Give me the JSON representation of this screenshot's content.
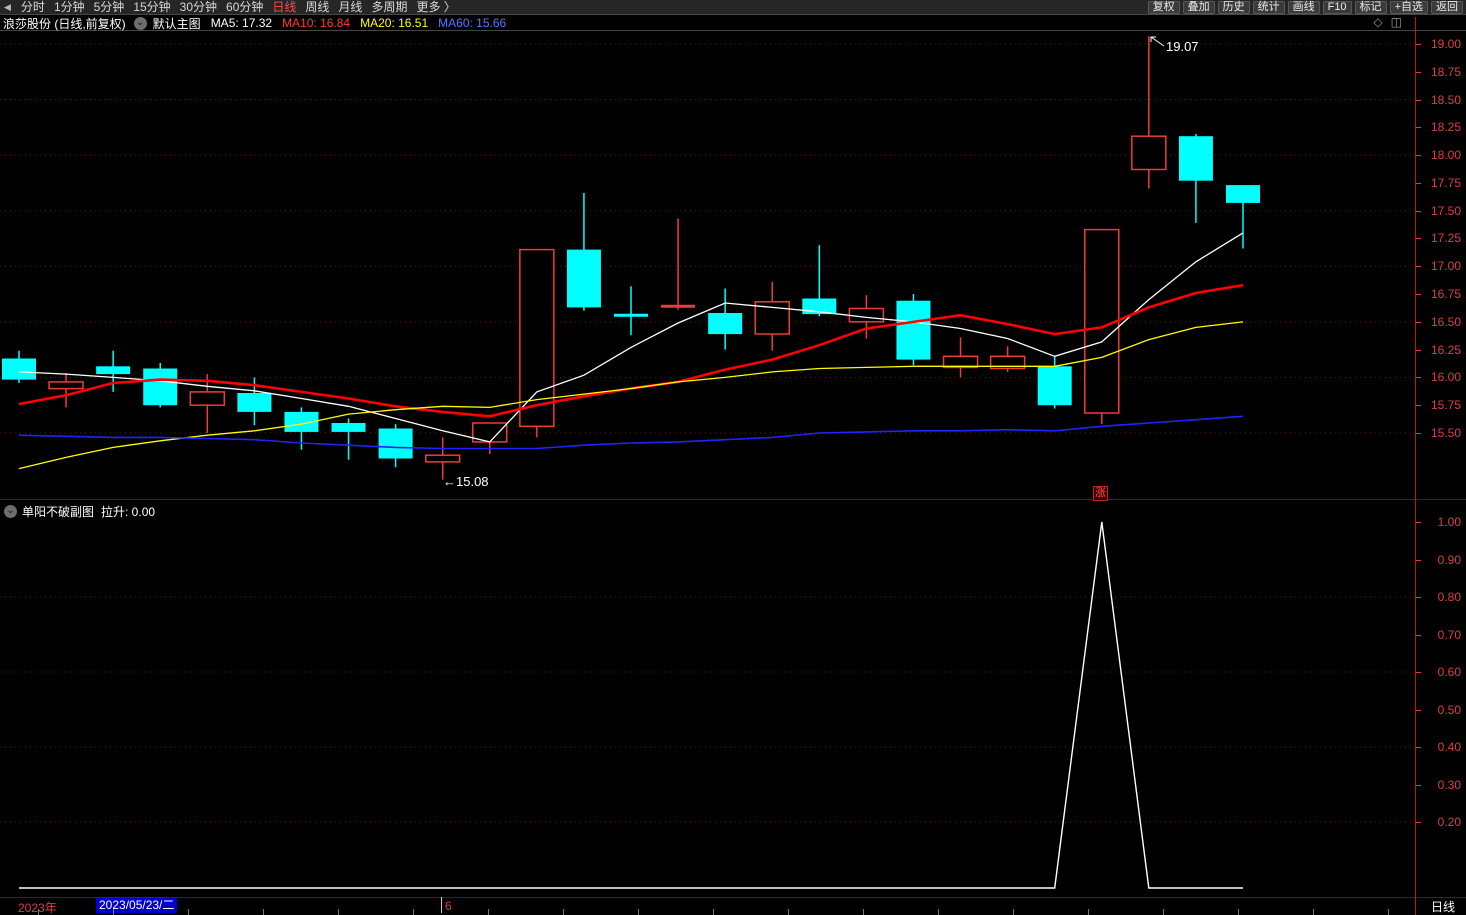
{
  "menubar": {
    "collapse_icon": "◀",
    "items": [
      {
        "label": "分时"
      },
      {
        "label": "1分钟"
      },
      {
        "label": "5分钟"
      },
      {
        "label": "15分钟"
      },
      {
        "label": "30分钟"
      },
      {
        "label": "60分钟"
      },
      {
        "label": "日线",
        "active": true
      },
      {
        "label": "周线"
      },
      {
        "label": "月线"
      },
      {
        "label": "多周期"
      },
      {
        "label": "更多 〉"
      }
    ],
    "right_items": [
      "复权",
      "叠加",
      "历史",
      "统计",
      "画线",
      "F10",
      "标记",
      "+自选",
      "返回"
    ]
  },
  "titlebar": {
    "stock_title": "浪莎股份 (日线,前复权)",
    "chevron_icon": "⌄",
    "layout_label": "默认主图",
    "ma_legend": [
      {
        "label": "MA5: 17.32",
        "color": "#ffffff"
      },
      {
        "label": "MA10: 16.84",
        "color": "#ff3a3a"
      },
      {
        "label": "MA20: 16.51",
        "color": "#ffff00"
      },
      {
        "label": "MA60: 15.66",
        "color": "#5577ff"
      }
    ],
    "diamond_icon": "◇",
    "split_icon": "◫"
  },
  "sub_chart": {
    "chevron_icon": "⌄",
    "name": "单阳不破副图",
    "value_label": "拉升: 0.00"
  },
  "annotations": {
    "high_label": "19.07",
    "low_label": "←15.08",
    "zhang_badge": "涨"
  },
  "right_axis": {
    "price_labels": [
      "19.00",
      "18.75",
      "18.50",
      "18.25",
      "18.00",
      "17.75",
      "17.50",
      "17.25",
      "17.00",
      "16.75",
      "16.50",
      "16.25",
      "16.00",
      "15.75",
      "15.50"
    ],
    "sub_labels": [
      "1.00",
      "0.90",
      "0.80",
      "0.70",
      "0.60",
      "0.50",
      "0.40",
      "0.30",
      "0.20"
    ],
    "period_label": "日线"
  },
  "datebar": {
    "year_label": "2023年",
    "selected_date": "2023/05/23/二",
    "month_label": "6"
  },
  "colors": {
    "up": "#ee3b3b",
    "down": "#00ffff",
    "grid": "#7c0a0a",
    "axis_text": "#d84040",
    "divider_red": "#8b0000",
    "axis_border": "#b31b1b",
    "date_highlight": "#0000cc",
    "spike": "#ffffff"
  },
  "chart_data": {
    "type": "candlestick",
    "title": "浪莎股份 日线 前复权 主图(MA5/MA10/MA20/MA60) + 单阳不破副图",
    "price_axis_visible_range": [
      15.5,
      19.0
    ],
    "sub_axis_visible_range": [
      0.2,
      1.0
    ],
    "price_gridlines": [
      19.0,
      18.5,
      18.0,
      17.5,
      17.0,
      16.5,
      16.0,
      15.5
    ],
    "sub_gridlines": [
      0.8,
      0.6,
      0.4,
      0.2
    ],
    "annotated_high": 19.07,
    "annotated_low": 15.08,
    "candles": [
      {
        "o": 16.17,
        "h": 16.24,
        "l": 15.95,
        "c": 15.98
      },
      {
        "o": 15.9,
        "h": 16.04,
        "l": 15.73,
        "c": 15.96
      },
      {
        "o": 16.1,
        "h": 16.24,
        "l": 15.87,
        "c": 16.03
      },
      {
        "o": 16.08,
        "h": 16.13,
        "l": 15.73,
        "c": 15.75
      },
      {
        "o": 15.75,
        "h": 16.03,
        "l": 15.5,
        "c": 15.87
      },
      {
        "o": 15.86,
        "h": 16.0,
        "l": 15.57,
        "c": 15.69
      },
      {
        "o": 15.69,
        "h": 15.73,
        "l": 15.35,
        "c": 15.51
      },
      {
        "o": 15.59,
        "h": 15.63,
        "l": 15.26,
        "c": 15.51
      },
      {
        "o": 15.54,
        "h": 15.58,
        "l": 15.19,
        "c": 15.27
      },
      {
        "o": 15.24,
        "h": 15.46,
        "l": 15.08,
        "c": 15.3
      },
      {
        "o": 15.42,
        "h": 15.59,
        "l": 15.31,
        "c": 15.59
      },
      {
        "o": 15.56,
        "h": 17.15,
        "l": 15.46,
        "c": 17.15
      },
      {
        "o": 17.15,
        "h": 17.66,
        "l": 16.6,
        "c": 16.63
      },
      {
        "o": 16.56,
        "h": 16.82,
        "l": 16.38,
        "c": 16.55
      },
      {
        "o": 16.64,
        "h": 17.43,
        "l": 16.61,
        "c": 16.64
      },
      {
        "o": 16.58,
        "h": 16.8,
        "l": 16.25,
        "c": 16.39
      },
      {
        "o": 16.39,
        "h": 16.86,
        "l": 16.24,
        "c": 16.68
      },
      {
        "o": 16.71,
        "h": 17.19,
        "l": 16.55,
        "c": 16.57
      },
      {
        "o": 16.5,
        "h": 16.74,
        "l": 16.35,
        "c": 16.62
      },
      {
        "o": 16.69,
        "h": 16.75,
        "l": 16.11,
        "c": 16.16
      },
      {
        "o": 16.09,
        "h": 16.36,
        "l": 16.0,
        "c": 16.19
      },
      {
        "o": 16.08,
        "h": 16.28,
        "l": 16.05,
        "c": 16.19
      },
      {
        "o": 16.1,
        "h": 16.19,
        "l": 15.72,
        "c": 15.75
      },
      {
        "o": 15.68,
        "h": 17.33,
        "l": 15.58,
        "c": 17.33
      },
      {
        "o": 17.87,
        "h": 19.07,
        "l": 17.7,
        "c": 18.17
      },
      {
        "o": 18.17,
        "h": 18.19,
        "l": 17.39,
        "c": 17.77
      },
      {
        "o": 17.73,
        "h": 17.73,
        "l": 17.16,
        "c": 17.57
      }
    ],
    "ma_series": [
      {
        "name": "MA5",
        "color": "#ffffff",
        "width": 1.3,
        "values": [
          16.05,
          16.03,
          16.0,
          15.97,
          15.92,
          15.88,
          15.81,
          15.74,
          15.63,
          15.52,
          15.42,
          15.87,
          16.02,
          16.27,
          16.49,
          16.67,
          16.63,
          16.59,
          16.54,
          16.5,
          16.44,
          16.35,
          16.19,
          16.32,
          16.7,
          17.04,
          17.3
        ]
      },
      {
        "name": "MA10",
        "color": "#ff0000",
        "width": 2.6,
        "values": [
          15.76,
          15.84,
          15.95,
          15.98,
          15.97,
          15.93,
          15.87,
          15.81,
          15.74,
          15.69,
          15.65,
          15.75,
          15.83,
          15.9,
          15.96,
          16.07,
          16.16,
          16.29,
          16.44,
          16.5,
          16.56,
          16.48,
          16.39,
          16.45,
          16.63,
          16.76,
          16.83
        ]
      },
      {
        "name": "MA20",
        "color": "#ffff00",
        "width": 1.3,
        "values": [
          15.18,
          15.28,
          15.37,
          15.43,
          15.48,
          15.52,
          15.58,
          15.67,
          15.71,
          15.74,
          15.73,
          15.8,
          15.85,
          15.9,
          15.96,
          16.0,
          16.05,
          16.08,
          16.09,
          16.1,
          16.1,
          16.1,
          16.1,
          16.18,
          16.34,
          16.45,
          16.5
        ]
      },
      {
        "name": "MA60",
        "color": "#2222ff",
        "width": 1.6,
        "values": [
          15.48,
          15.47,
          15.46,
          15.46,
          15.45,
          15.44,
          15.41,
          15.39,
          15.37,
          15.36,
          15.36,
          15.36,
          15.39,
          15.41,
          15.42,
          15.44,
          15.46,
          15.5,
          15.51,
          15.52,
          15.52,
          15.53,
          15.52,
          15.56,
          15.59,
          15.62,
          15.65
        ]
      }
    ],
    "indicator": {
      "name": "拉升",
      "color": "#ffffff",
      "values": [
        0,
        0,
        0,
        0,
        0,
        0,
        0,
        0,
        0,
        0,
        0,
        0,
        0,
        0,
        0,
        0,
        0,
        0,
        0,
        0,
        0,
        0,
        0,
        1,
        0,
        0,
        0
      ]
    }
  }
}
